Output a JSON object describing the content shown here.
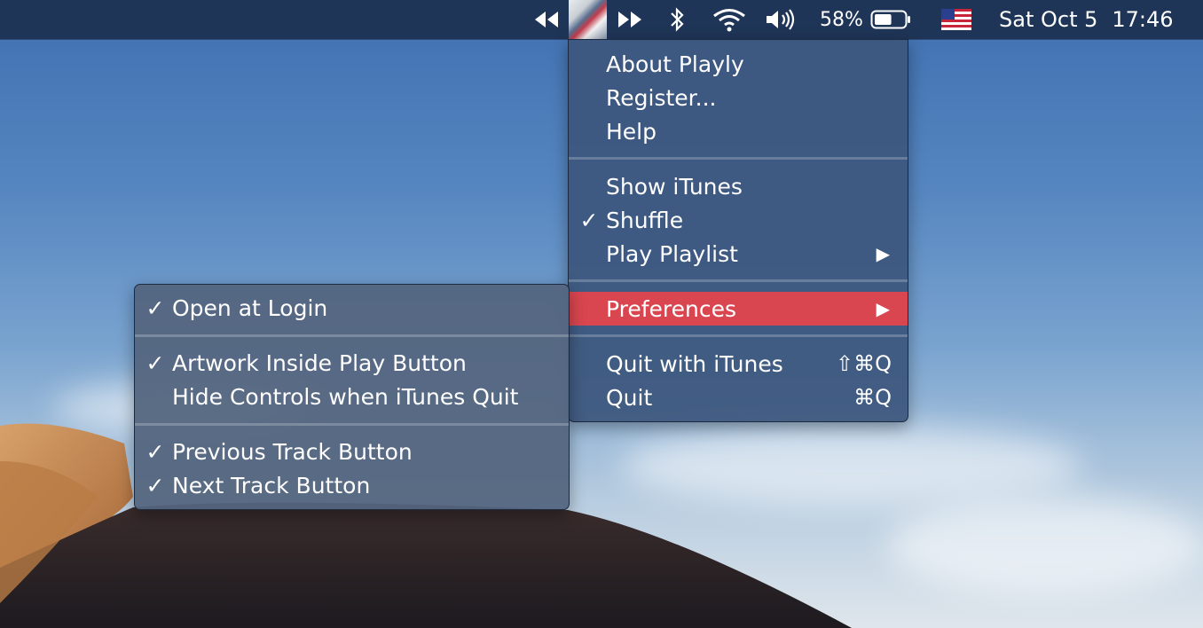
{
  "menubar": {
    "battery_percent": "58%",
    "battery_level": 0.58,
    "date": "Sat Oct 5",
    "time": "17:46",
    "icons": [
      "rewind-icon",
      "artwork-thumbnail",
      "fast-forward-icon",
      "bluetooth-icon",
      "wifi-icon",
      "volume-icon",
      "battery-icon",
      "us-flag-icon"
    ]
  },
  "main_menu": {
    "about": "About Playly",
    "register": "Register...",
    "help": "Help",
    "show_itunes": "Show iTunes",
    "shuffle": "Shuffle",
    "play_playlist": "Play Playlist",
    "preferences": "Preferences",
    "quit_with_itunes": "Quit with iTunes",
    "quit_with_itunes_shortcut": "⇧⌘Q",
    "quit": "Quit",
    "quit_shortcut": "⌘Q",
    "checkmark": "✓",
    "submenu_arrow": "▶",
    "highlight_color": "#d9464f"
  },
  "preferences_menu": {
    "open_at_login": "Open at Login",
    "artwork_inside_play": "Artwork Inside Play Button",
    "hide_controls": "Hide Controls when iTunes Quit",
    "previous_track": "Previous Track Button",
    "next_track": "Next Track Button",
    "checkmark": "✓"
  }
}
